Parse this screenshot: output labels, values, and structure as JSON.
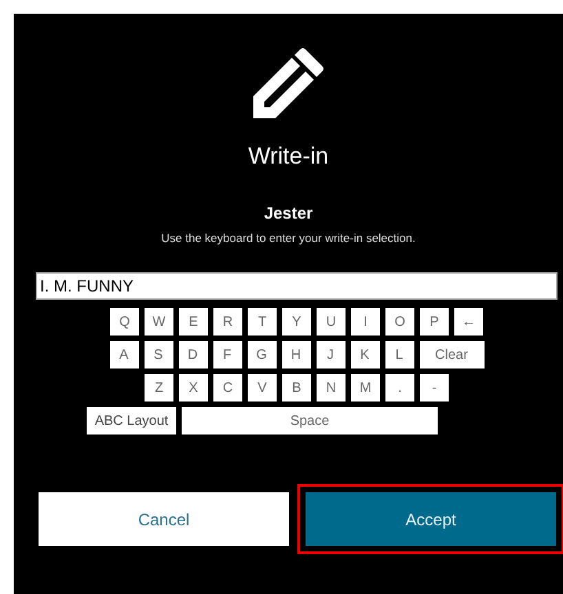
{
  "dialog": {
    "title": "Write-in",
    "contest": "Jester",
    "instructions": "Use the keyboard to enter your write-in selection."
  },
  "write_in": {
    "value": "I. M. FUNNY"
  },
  "keyboard": {
    "top_row": [
      {
        "label": "Q",
        "kind": "char"
      },
      {
        "label": "W",
        "kind": "char"
      },
      {
        "label": "E",
        "kind": "char"
      },
      {
        "label": "R",
        "kind": "char"
      },
      {
        "label": "T",
        "kind": "char"
      },
      {
        "label": "Y",
        "kind": "char"
      },
      {
        "label": "U",
        "kind": "char"
      },
      {
        "label": "I",
        "kind": "char"
      },
      {
        "label": "O",
        "kind": "char"
      },
      {
        "label": "P",
        "kind": "char"
      },
      {
        "label": "←",
        "kind": "char"
      }
    ],
    "home_row": [
      {
        "label": "A",
        "kind": "char"
      },
      {
        "label": "S",
        "kind": "char"
      },
      {
        "label": "D",
        "kind": "char"
      },
      {
        "label": "F",
        "kind": "char"
      },
      {
        "label": "G",
        "kind": "char"
      },
      {
        "label": "H",
        "kind": "char"
      },
      {
        "label": "J",
        "kind": "char"
      },
      {
        "label": "K",
        "kind": "char"
      },
      {
        "label": "L",
        "kind": "char"
      },
      {
        "label": "Clear",
        "kind": "wide"
      }
    ],
    "bottom_row": [
      {
        "label": "Z",
        "kind": "char"
      },
      {
        "label": "X",
        "kind": "char"
      },
      {
        "label": "C",
        "kind": "char"
      },
      {
        "label": "V",
        "kind": "char"
      },
      {
        "label": "B",
        "kind": "char"
      },
      {
        "label": "N",
        "kind": "char"
      },
      {
        "label": "M",
        "kind": "char"
      },
      {
        "label": ".",
        "kind": "char"
      },
      {
        "label": "-",
        "kind": "char"
      }
    ],
    "function_row": [
      {
        "label": "ABC Layout",
        "kind": "layout"
      },
      {
        "label": "Space",
        "kind": "space"
      }
    ]
  },
  "buttons": [
    {
      "label": "Cancel",
      "kind": "secondary",
      "highlighted": false
    },
    {
      "label": "Accept",
      "kind": "primary",
      "highlighted": true
    }
  ]
}
